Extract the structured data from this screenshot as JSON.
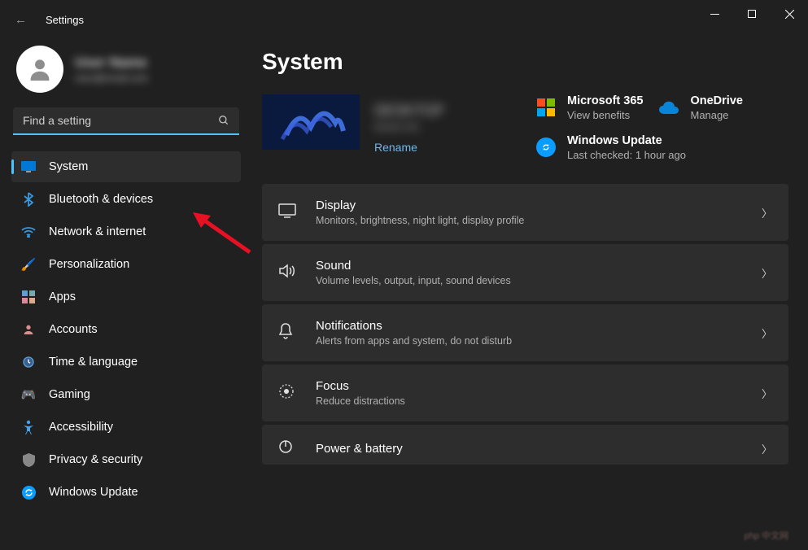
{
  "window": {
    "title": "Settings"
  },
  "user": {
    "name": "User Name",
    "email": "user@email.com"
  },
  "search": {
    "placeholder": "Find a setting"
  },
  "nav": [
    {
      "id": "system",
      "label": "System",
      "active": true
    },
    {
      "id": "bluetooth",
      "label": "Bluetooth & devices"
    },
    {
      "id": "network",
      "label": "Network & internet"
    },
    {
      "id": "personalization",
      "label": "Personalization"
    },
    {
      "id": "apps",
      "label": "Apps"
    },
    {
      "id": "accounts",
      "label": "Accounts"
    },
    {
      "id": "time",
      "label": "Time & language"
    },
    {
      "id": "gaming",
      "label": "Gaming"
    },
    {
      "id": "accessibility",
      "label": "Accessibility"
    },
    {
      "id": "privacy",
      "label": "Privacy & security"
    },
    {
      "id": "update",
      "label": "Windows Update"
    }
  ],
  "page": {
    "title": "System",
    "device_name": "DESKTOP",
    "device_sub": "Model info",
    "rename": "Rename"
  },
  "cards": {
    "m365": {
      "title": "Microsoft 365",
      "sub": "View benefits"
    },
    "onedrive": {
      "title": "OneDrive",
      "sub": "Manage"
    },
    "update": {
      "title": "Windows Update",
      "sub": "Last checked: 1 hour ago"
    }
  },
  "settings": [
    {
      "id": "display",
      "title": "Display",
      "sub": "Monitors, brightness, night light, display profile"
    },
    {
      "id": "sound",
      "title": "Sound",
      "sub": "Volume levels, output, input, sound devices"
    },
    {
      "id": "notifications",
      "title": "Notifications",
      "sub": "Alerts from apps and system, do not disturb"
    },
    {
      "id": "focus",
      "title": "Focus",
      "sub": "Reduce distractions"
    },
    {
      "id": "power",
      "title": "Power & battery",
      "sub": ""
    }
  ]
}
